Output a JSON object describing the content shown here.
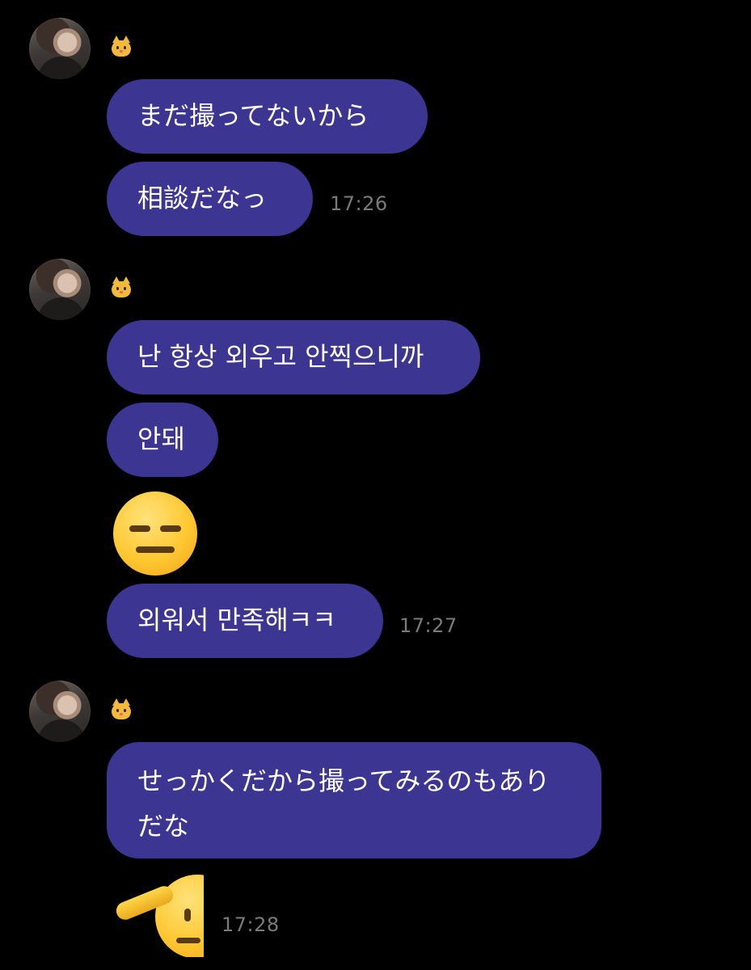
{
  "messages": [
    {
      "nickname_icon": "cat-face-emoji",
      "bubbles": [
        "まだ撮ってないから",
        "相談だなっ"
      ],
      "time": "17:26"
    },
    {
      "nickname_icon": "cat-face-emoji",
      "bubbles": [
        "난 항상 외우고 안찍으니까",
        "안돼",
        "외워서 만족해ㅋㅋ"
      ],
      "emoji": "expressionless-face",
      "time": "17:27"
    },
    {
      "nickname_icon": "cat-face-emoji",
      "bubbles": [
        "せっかくだから撮ってみるのもありだな"
      ],
      "emoji": "saluting-face",
      "time": "17:28"
    }
  ],
  "colors": {
    "background": "#000000",
    "bubble": "#3d3592",
    "text": "#ffffff",
    "time": "#7a7a7a"
  }
}
